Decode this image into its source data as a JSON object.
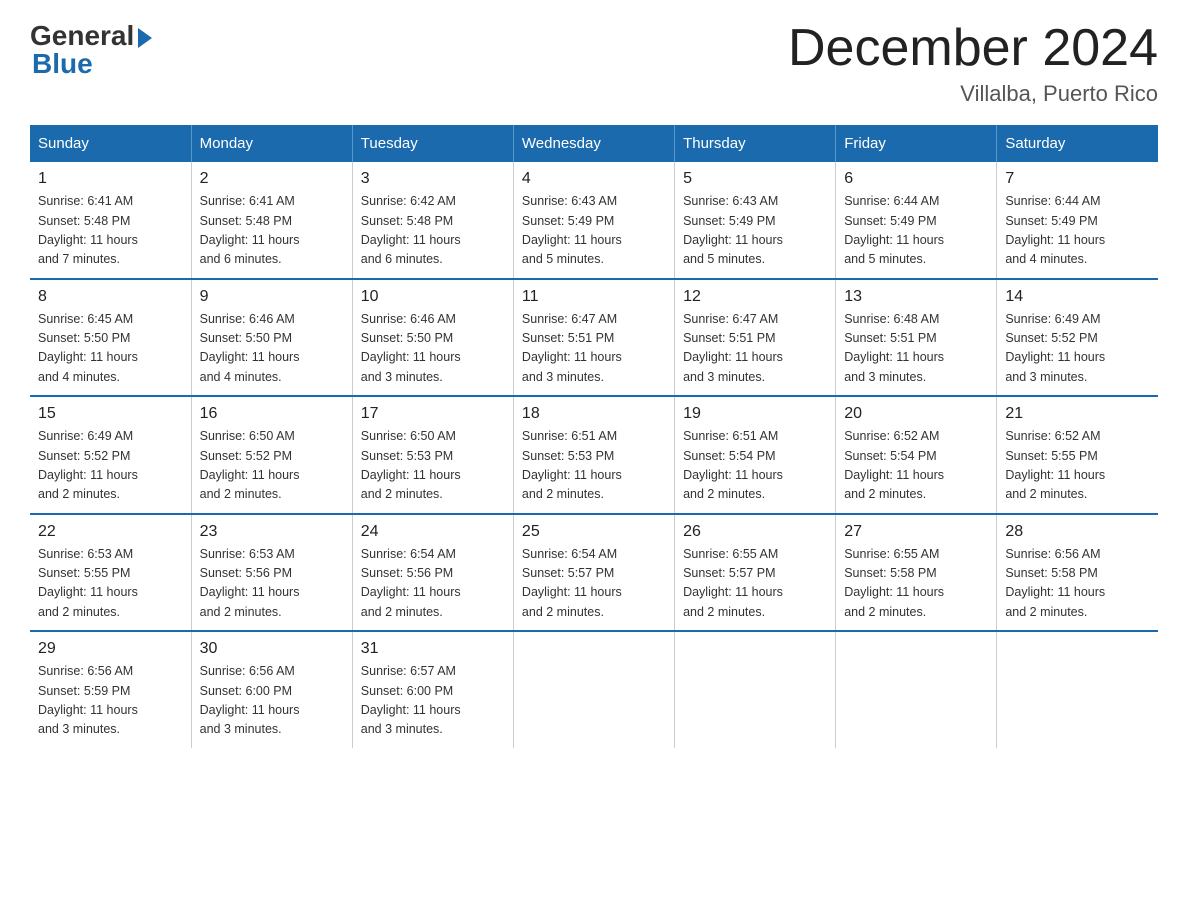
{
  "logo": {
    "general": "General",
    "blue": "Blue"
  },
  "title": "December 2024",
  "subtitle": "Villalba, Puerto Rico",
  "headers": [
    "Sunday",
    "Monday",
    "Tuesday",
    "Wednesday",
    "Thursday",
    "Friday",
    "Saturday"
  ],
  "weeks": [
    [
      {
        "day": "1",
        "sunrise": "6:41 AM",
        "sunset": "5:48 PM",
        "daylight": "11 hours and 7 minutes."
      },
      {
        "day": "2",
        "sunrise": "6:41 AM",
        "sunset": "5:48 PM",
        "daylight": "11 hours and 6 minutes."
      },
      {
        "day": "3",
        "sunrise": "6:42 AM",
        "sunset": "5:48 PM",
        "daylight": "11 hours and 6 minutes."
      },
      {
        "day": "4",
        "sunrise": "6:43 AM",
        "sunset": "5:49 PM",
        "daylight": "11 hours and 5 minutes."
      },
      {
        "day": "5",
        "sunrise": "6:43 AM",
        "sunset": "5:49 PM",
        "daylight": "11 hours and 5 minutes."
      },
      {
        "day": "6",
        "sunrise": "6:44 AM",
        "sunset": "5:49 PM",
        "daylight": "11 hours and 5 minutes."
      },
      {
        "day": "7",
        "sunrise": "6:44 AM",
        "sunset": "5:49 PM",
        "daylight": "11 hours and 4 minutes."
      }
    ],
    [
      {
        "day": "8",
        "sunrise": "6:45 AM",
        "sunset": "5:50 PM",
        "daylight": "11 hours and 4 minutes."
      },
      {
        "day": "9",
        "sunrise": "6:46 AM",
        "sunset": "5:50 PM",
        "daylight": "11 hours and 4 minutes."
      },
      {
        "day": "10",
        "sunrise": "6:46 AM",
        "sunset": "5:50 PM",
        "daylight": "11 hours and 3 minutes."
      },
      {
        "day": "11",
        "sunrise": "6:47 AM",
        "sunset": "5:51 PM",
        "daylight": "11 hours and 3 minutes."
      },
      {
        "day": "12",
        "sunrise": "6:47 AM",
        "sunset": "5:51 PM",
        "daylight": "11 hours and 3 minutes."
      },
      {
        "day": "13",
        "sunrise": "6:48 AM",
        "sunset": "5:51 PM",
        "daylight": "11 hours and 3 minutes."
      },
      {
        "day": "14",
        "sunrise": "6:49 AM",
        "sunset": "5:52 PM",
        "daylight": "11 hours and 3 minutes."
      }
    ],
    [
      {
        "day": "15",
        "sunrise": "6:49 AM",
        "sunset": "5:52 PM",
        "daylight": "11 hours and 2 minutes."
      },
      {
        "day": "16",
        "sunrise": "6:50 AM",
        "sunset": "5:52 PM",
        "daylight": "11 hours and 2 minutes."
      },
      {
        "day": "17",
        "sunrise": "6:50 AM",
        "sunset": "5:53 PM",
        "daylight": "11 hours and 2 minutes."
      },
      {
        "day": "18",
        "sunrise": "6:51 AM",
        "sunset": "5:53 PM",
        "daylight": "11 hours and 2 minutes."
      },
      {
        "day": "19",
        "sunrise": "6:51 AM",
        "sunset": "5:54 PM",
        "daylight": "11 hours and 2 minutes."
      },
      {
        "day": "20",
        "sunrise": "6:52 AM",
        "sunset": "5:54 PM",
        "daylight": "11 hours and 2 minutes."
      },
      {
        "day": "21",
        "sunrise": "6:52 AM",
        "sunset": "5:55 PM",
        "daylight": "11 hours and 2 minutes."
      }
    ],
    [
      {
        "day": "22",
        "sunrise": "6:53 AM",
        "sunset": "5:55 PM",
        "daylight": "11 hours and 2 minutes."
      },
      {
        "day": "23",
        "sunrise": "6:53 AM",
        "sunset": "5:56 PM",
        "daylight": "11 hours and 2 minutes."
      },
      {
        "day": "24",
        "sunrise": "6:54 AM",
        "sunset": "5:56 PM",
        "daylight": "11 hours and 2 minutes."
      },
      {
        "day": "25",
        "sunrise": "6:54 AM",
        "sunset": "5:57 PM",
        "daylight": "11 hours and 2 minutes."
      },
      {
        "day": "26",
        "sunrise": "6:55 AM",
        "sunset": "5:57 PM",
        "daylight": "11 hours and 2 minutes."
      },
      {
        "day": "27",
        "sunrise": "6:55 AM",
        "sunset": "5:58 PM",
        "daylight": "11 hours and 2 minutes."
      },
      {
        "day": "28",
        "sunrise": "6:56 AM",
        "sunset": "5:58 PM",
        "daylight": "11 hours and 2 minutes."
      }
    ],
    [
      {
        "day": "29",
        "sunrise": "6:56 AM",
        "sunset": "5:59 PM",
        "daylight": "11 hours and 3 minutes."
      },
      {
        "day": "30",
        "sunrise": "6:56 AM",
        "sunset": "6:00 PM",
        "daylight": "11 hours and 3 minutes."
      },
      {
        "day": "31",
        "sunrise": "6:57 AM",
        "sunset": "6:00 PM",
        "daylight": "11 hours and 3 minutes."
      },
      null,
      null,
      null,
      null
    ]
  ],
  "labels": {
    "sunrise_prefix": "Sunrise: ",
    "sunset_prefix": "Sunset: ",
    "daylight_prefix": "Daylight: "
  }
}
